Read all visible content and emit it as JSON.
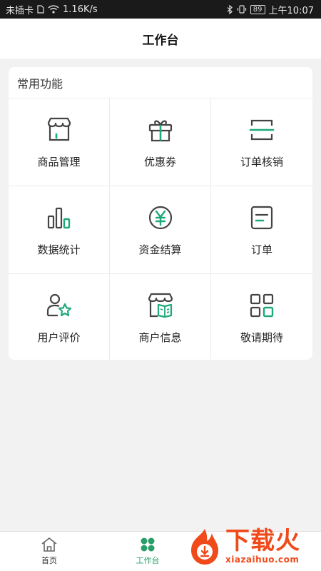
{
  "status_bar": {
    "carrier": "未插卡",
    "speed": "1.16K/s",
    "battery": "89",
    "time": "上午10:07"
  },
  "header": {
    "title": "工作台"
  },
  "section": {
    "title": "常用功能",
    "items": [
      {
        "label": "商品管理",
        "icon": "store-icon"
      },
      {
        "label": "优惠券",
        "icon": "gift-icon"
      },
      {
        "label": "订单核销",
        "icon": "scan-icon"
      },
      {
        "label": "数据统计",
        "icon": "bar-chart-icon"
      },
      {
        "label": "资金结算",
        "icon": "yen-coin-icon"
      },
      {
        "label": "订单",
        "icon": "order-icon"
      },
      {
        "label": "用户评价",
        "icon": "user-star-icon"
      },
      {
        "label": "商户信息",
        "icon": "shop-info-icon"
      },
      {
        "label": "敬请期待",
        "icon": "grid-apps-icon"
      }
    ]
  },
  "bottom_nav": {
    "tabs": [
      {
        "label": "首页",
        "icon": "home-icon",
        "active": false
      },
      {
        "label": "工作台",
        "icon": "clover-icon",
        "active": true
      }
    ]
  },
  "watermark": {
    "title": "下载火",
    "domain": "xiazaihuo.com"
  },
  "colors": {
    "accent": "#1fa97a",
    "icon_stroke": "#444444",
    "background": "#f2f2f2"
  }
}
